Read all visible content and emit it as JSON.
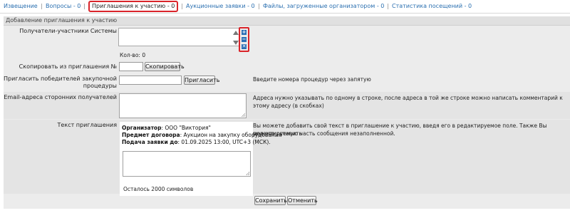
{
  "tabs": [
    {
      "label": "Извещение",
      "active": false
    },
    {
      "label": "Вопросы - 0",
      "active": false
    },
    {
      "label": "Приглашения к участию - 0",
      "active": true
    },
    {
      "label": "Аукционные заявки - 0",
      "active": false
    },
    {
      "label": "Файлы, загруженные организатором - 0",
      "active": false
    },
    {
      "label": "Статистика посещений - 0",
      "active": false
    }
  ],
  "tab_separator": "|",
  "section": {
    "title": "Добавление приглашения к участию"
  },
  "recipients": {
    "label": "Получатели-участники Системы",
    "count_label": "Кол-во: 0",
    "controls": [
      {
        "name": "add",
        "glyph": "+"
      },
      {
        "name": "remove",
        "glyph": "−"
      },
      {
        "name": "clear",
        "glyph": "✕"
      }
    ]
  },
  "copy": {
    "label": "Скопировать из приглашения №",
    "value": "",
    "button": "Скопировать"
  },
  "invite_winners": {
    "label_line1": "Пригласить победителей закупочной",
    "label_line2": "процедуры",
    "value": "",
    "button": "Пригласить",
    "hint": "Введите номера процедур через запятую"
  },
  "emails": {
    "label": "Email-адреса сторонних получателей",
    "value": "",
    "hint": "Адреса нужно указывать по одному в строке, после адреса в той же строке можно написать комментарий к этому адресу (в скобках)"
  },
  "message": {
    "label": "Текст приглашения",
    "organizer_label": "Организатор",
    "organizer_value": ": ООО \"Виктория\"",
    "subject_label": "Предмет договора",
    "subject_value": ": Аукцион на закупку оборудования",
    "deadline_label": "Подача заявки до",
    "deadline_value": ": 01.09.2025 13:00, UTC+3 (МСК).",
    "editable_value": "",
    "remaining": "Осталось 2000 символов",
    "hint_line1": "Вы можете добавить свой текст в приглашение к участию, введя его в редактируемое поле. Также Вы можете оставить",
    "hint_line2": "редактируемую часть сообщения незаполненной."
  },
  "actions": {
    "save": "Сохранить",
    "cancel": "Отменить"
  },
  "colors": {
    "link": "#2a6fb0",
    "highlight": "#d9242a",
    "panel": "#ececec",
    "icon_button": "#2d6fb5"
  }
}
